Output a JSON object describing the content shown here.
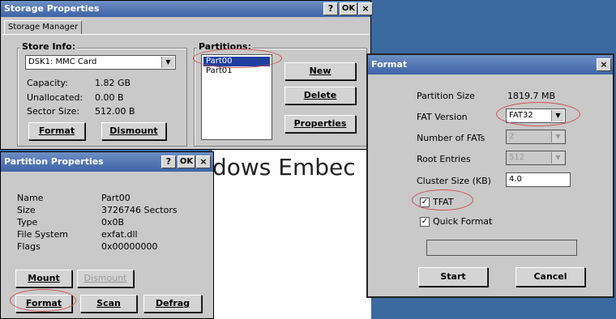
{
  "storage": {
    "title": "Storage Properties",
    "help": "?",
    "ok": "OK",
    "close": "×",
    "tab": "Storage Manager",
    "store_group": "Store Info:",
    "store_select": "DSK1: MMC Card",
    "capacity_label": "Capacity:",
    "capacity_value": "1.82 GB",
    "unallocated_label": "Unallocated:",
    "unallocated_value": "0.00 B",
    "sector_label": "Sector Size:",
    "sector_value": "512.00 B",
    "format_btn": "Format",
    "dismount_btn": "Dismount",
    "partitions_group": "Partitions:",
    "partitions": [
      "Part00",
      "Part01"
    ],
    "new_btn": "New",
    "delete_btn": "Delete",
    "properties_btn": "Properties"
  },
  "partition": {
    "title": "Partition Properties",
    "help": "?",
    "ok": "OK",
    "close": "×",
    "rows": [
      {
        "label": "Name",
        "value": "Part00"
      },
      {
        "label": "Size",
        "value": "3726746 Sectors"
      },
      {
        "label": "Type",
        "value": "0x0B"
      },
      {
        "label": "File System",
        "value": "exfat.dll"
      },
      {
        "label": "Flags",
        "value": "0x00000000"
      }
    ],
    "mount_btn": "Mount",
    "dismount_btn": "Dismount",
    "format_btn": "Format",
    "scan_btn": "Scan",
    "defrag_btn": "Defrag"
  },
  "background_text": "dows Embec",
  "format": {
    "title": "Format",
    "close": "×",
    "partition_size_label": "Partition Size",
    "partition_size_value": "1819.7 MB",
    "fat_version_label": "FAT Version",
    "fat_version_value": "FAT32",
    "num_fats_label": "Number of FATs",
    "num_fats_value": "2",
    "root_entries_label": "Root Entries",
    "root_entries_value": "512",
    "cluster_size_label": "Cluster Size (KB)",
    "cluster_size_value": "4.0",
    "tfat_label": "TFAT",
    "quick_format_label": "Quick Format",
    "start_btn": "Start",
    "cancel_btn": "Cancel"
  },
  "colors": {
    "desktop": "#3a6aa0",
    "window": "#c9c9c9",
    "titlebar": "#3e63a6",
    "selection": "#1f3f9f",
    "highlight_oval": "#d05050"
  }
}
